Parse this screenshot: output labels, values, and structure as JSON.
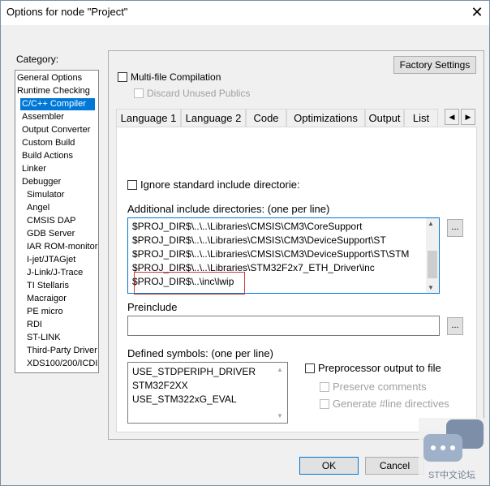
{
  "window": {
    "title": "Options for node \"Project\"",
    "close_glyph": "✕"
  },
  "category": {
    "label": "Category:",
    "items": [
      "General Options",
      "Runtime Checking",
      "C/C++ Compiler",
      "Assembler",
      "Output Converter",
      "Custom Build",
      "Build Actions",
      "Linker",
      "Debugger",
      "Simulator",
      "Angel",
      "CMSIS DAP",
      "GDB Server",
      "IAR ROM-monitor",
      "I-jet/JTAGjet",
      "J-Link/J-Trace",
      "TI Stellaris",
      "Macraigor",
      "PE micro",
      "RDI",
      "ST-LINK",
      "Third-Party Driver",
      "XDS100/200/ICDI"
    ],
    "selected": "C/C++ Compiler"
  },
  "options": {
    "factory_settings": "Factory Settings",
    "multi_file": "Multi-file Compilation",
    "discard_unused": "Discard Unused Publics"
  },
  "tabs": [
    "Language 1",
    "Language 2",
    "Code",
    "Optimizations",
    "Output",
    "List"
  ],
  "tab_arrows": {
    "left": "◀",
    "right": "▶"
  },
  "preprocessor": {
    "ignore_std": "Ignore standard include directorie:",
    "additional_label": "Additional include directories: (one per line)",
    "include_lines": [
      "$PROJ_DIR$\\..\\..\\Libraries\\CMSIS\\CM3\\CoreSupport",
      "$PROJ_DIR$\\..\\..\\Libraries\\CMSIS\\CM3\\DeviceSupport\\ST",
      "$PROJ_DIR$\\..\\..\\Libraries\\CMSIS\\CM3\\DeviceSupport\\ST\\STM",
      "$PROJ_DIR$\\..\\..\\Libraries\\STM32F2x7_ETH_Driver\\inc",
      "$PROJ_DIR$\\..\\inc\\lwip"
    ],
    "browse": "...",
    "preinclude_label": "Preinclude",
    "preinclude_value": "",
    "defined_label": "Defined symbols: (one per line)",
    "defined_lines": [
      "USE_STDPERIPH_DRIVER",
      "STM32F2XX",
      "USE_STM322xG_EVAL"
    ],
    "pp_output": "Preprocessor output to file",
    "preserve_comments": "Preserve comments",
    "generate_line": "Generate #line directives"
  },
  "buttons": {
    "ok": "OK",
    "cancel": "Cancel"
  },
  "watermark": {
    "text": "ST中文论坛"
  }
}
